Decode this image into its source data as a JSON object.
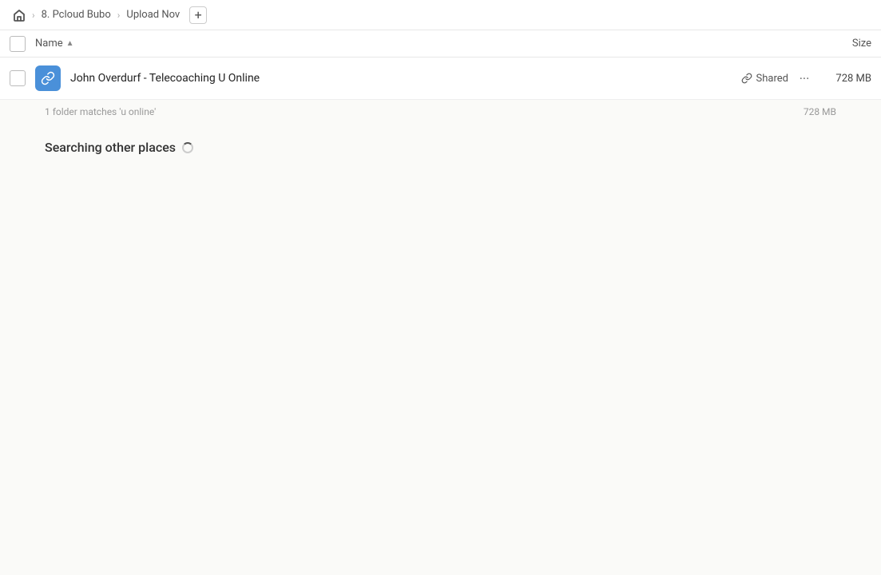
{
  "breadcrumb": {
    "home_icon": "home",
    "items": [
      {
        "label": "8. Pcloud Bubo"
      },
      {
        "label": "Upload Nov"
      }
    ],
    "add_label": "+"
  },
  "columns": {
    "checkbox_label": "",
    "name_label": "Name",
    "sort_arrow": "▲",
    "size_label": "Size"
  },
  "file_row": {
    "name": "John Overdurf - Telecoaching U Online",
    "shared_label": "Shared",
    "size": "728 MB"
  },
  "summary": {
    "text": "1 folder matches 'u online'",
    "size": "728 MB"
  },
  "searching": {
    "label": "Searching other places"
  }
}
